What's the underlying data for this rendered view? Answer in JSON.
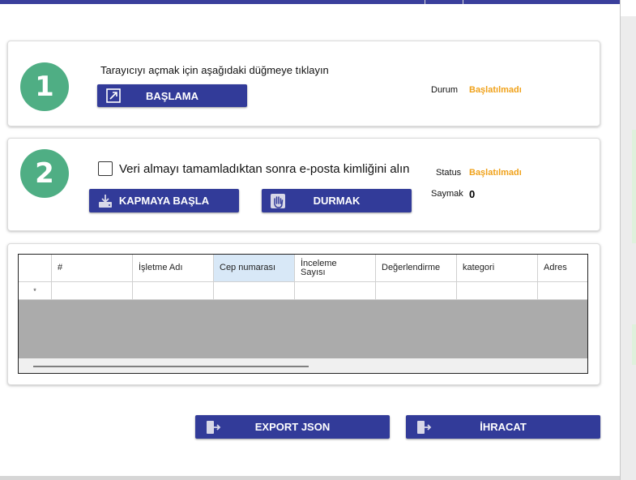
{
  "step1": {
    "number": "1",
    "instruction": "Tarayıcıyı açmak için aşağıdaki düğmeye tıklayın",
    "start_button_label": "BAŞLAMA",
    "start_button_icon": "open-external-icon",
    "status_label": "Durum",
    "status_value": "Başlatılmadı"
  },
  "step2": {
    "number": "2",
    "checkbox_label": "Veri almayı tamamladıktan sonra e-posta kimliğini alın",
    "checkbox_checked": false,
    "status_label": "Status",
    "status_value": "Başlatılmadı",
    "counter_label": "Saymak",
    "counter_value": "0",
    "capture_button_label": "KAPMAYA BAŞLA",
    "capture_button_icon": "download-tray-icon",
    "stop_button_label": "DURMAK",
    "stop_button_icon": "hand-stop-icon"
  },
  "grid": {
    "columns": [
      "#",
      "İşletme Adı",
      "Cep numarası",
      "İnceleme\nSayısı",
      "Değerlendirme",
      "kategori",
      "Adres"
    ],
    "selected_column": "Cep numarası",
    "new_row_marker": "*",
    "rows": []
  },
  "actions": {
    "export_json_label": "EXPORT JSON",
    "export_json_icon": "export-icon",
    "export_label": "İHRACAT",
    "export_icon": "export-icon"
  },
  "colors": {
    "accent": "#323b99",
    "step_circle": "#4fae84",
    "status_pending": "#f0a21b"
  }
}
